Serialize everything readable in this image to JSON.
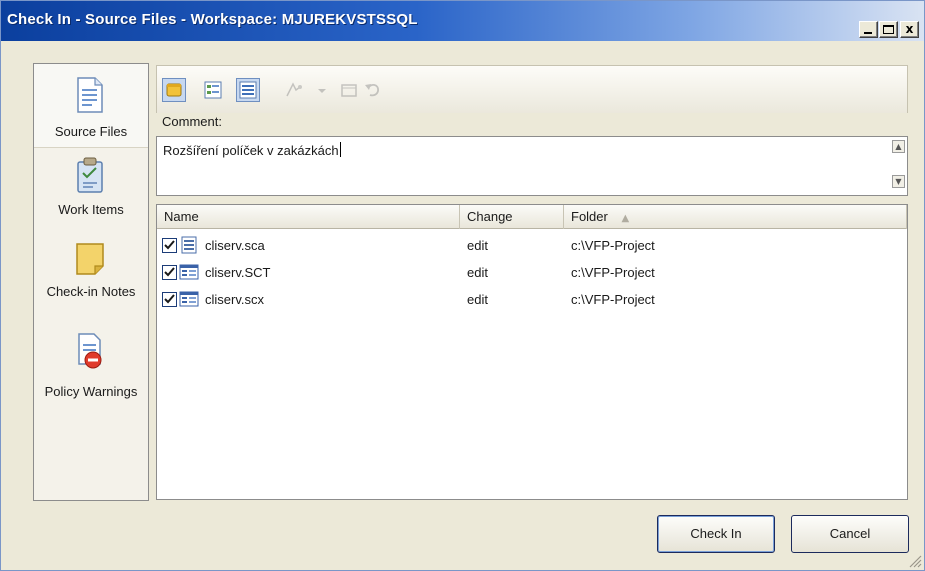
{
  "window": {
    "title": "Check In - Source Files - Workspace: MJUREKVSTSSQL",
    "controls": {
      "minimize": "_",
      "maximize": "□",
      "close": "x"
    }
  },
  "nav": {
    "items": [
      {
        "label": "Source Files",
        "icon": "source-files-icon",
        "active": true
      },
      {
        "label": "Work Items",
        "icon": "work-items-icon",
        "active": false
      },
      {
        "label": "Check-in Notes",
        "icon": "check-in-notes-icon",
        "active": false
      },
      {
        "label": "Policy Warnings",
        "icon": "policy-warnings-icon",
        "active": false
      }
    ]
  },
  "toolbar": {
    "buttons": [
      {
        "icon": "flat-view-icon",
        "pressed": true
      },
      {
        "icon": "tree-view-icon",
        "pressed": false
      },
      {
        "icon": "list-view-icon",
        "pressed": true
      },
      {
        "icon": "compare-icon",
        "enabled": false
      },
      {
        "icon": "dropdown-arrow-icon",
        "enabled": false
      },
      {
        "icon": "shelve-icon",
        "enabled": false
      },
      {
        "icon": "undo-icon",
        "enabled": false
      }
    ]
  },
  "comment": {
    "label": "Comment:",
    "value": "Rozšíření políček v zakázkách",
    "scroll_up": "▲",
    "scroll_down": "▼"
  },
  "list": {
    "columns": [
      {
        "label": "Name"
      },
      {
        "label": "Change"
      },
      {
        "label": "Folder",
        "sort_indicator": "▲"
      }
    ],
    "rows": [
      {
        "checked": true,
        "icon": "text-file-icon",
        "name": "cliserv.sca",
        "change": "edit",
        "folder": "c:\\VFP-Project"
      },
      {
        "checked": true,
        "icon": "form-file-icon",
        "name": "cliserv.SCT",
        "change": "edit",
        "folder": "c:\\VFP-Project"
      },
      {
        "checked": true,
        "icon": "form-file-icon",
        "name": "cliserv.scx",
        "change": "edit",
        "folder": "c:\\VFP-Project"
      }
    ]
  },
  "buttons": {
    "check_in": "Check In",
    "cancel": "Cancel"
  },
  "colors": {
    "title_bar_start": "#0b3f9e",
    "title_bar_end": "#d9e3f3",
    "dialog_background": "#ece9d8",
    "pressed_button": "#c7d8f0"
  }
}
